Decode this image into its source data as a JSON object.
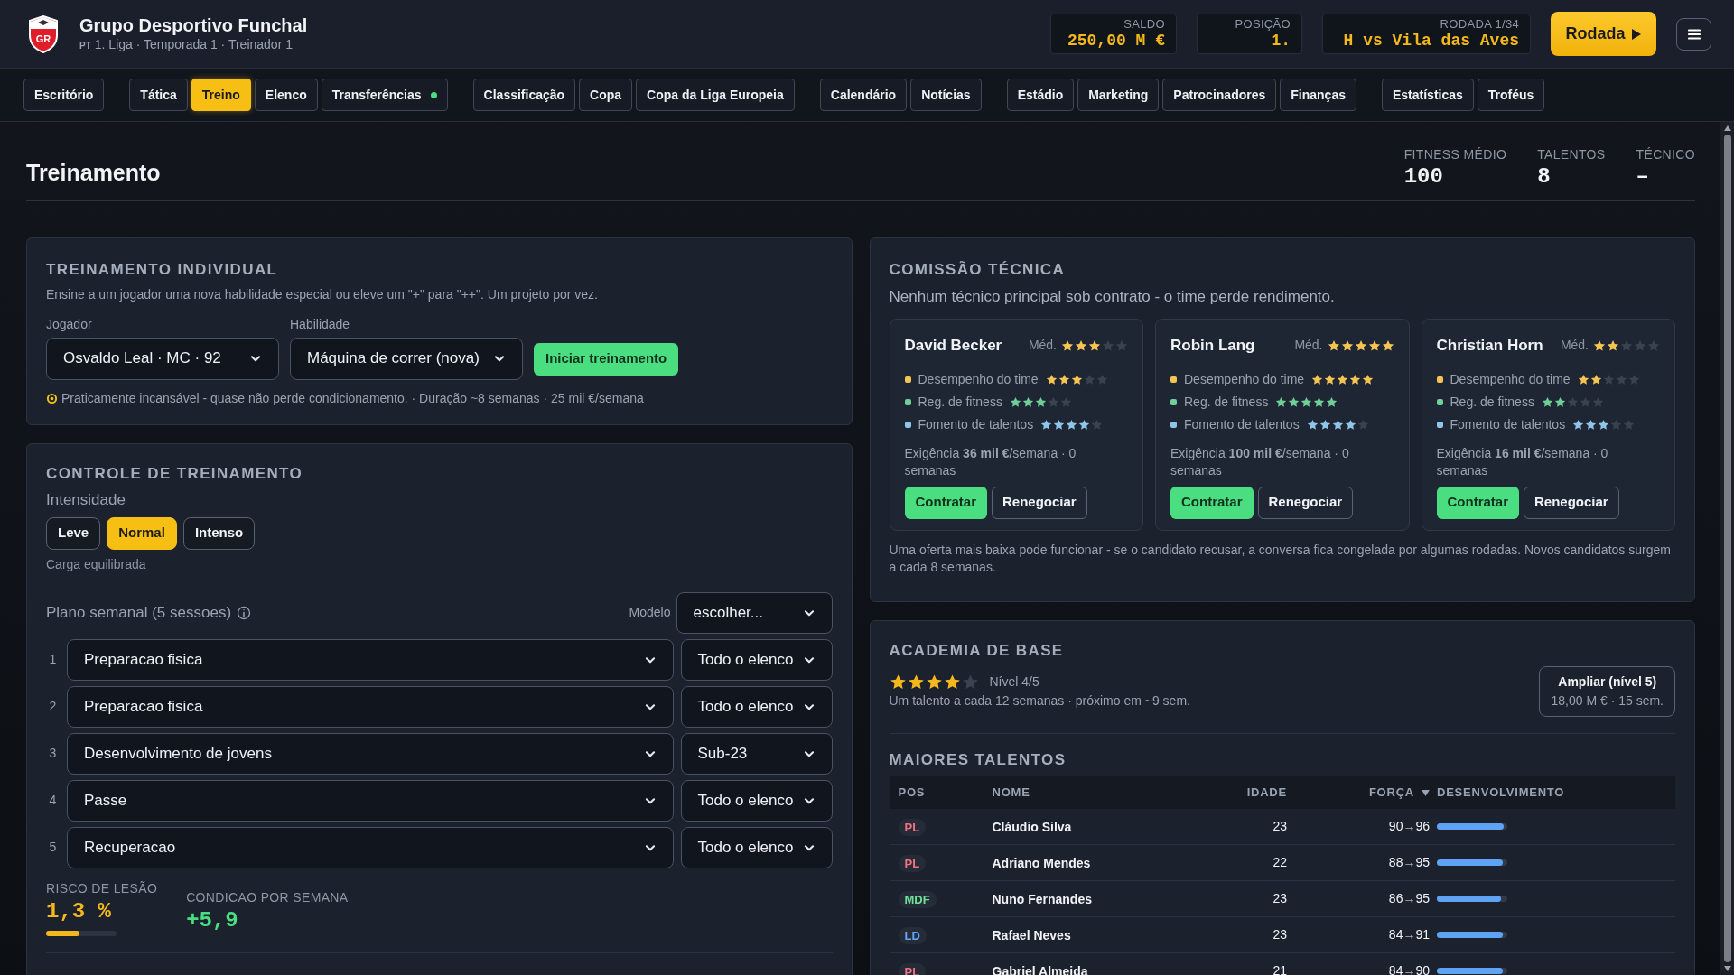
{
  "header": {
    "logo_text": "GR",
    "club": "Grupo Desportivo Funchal",
    "country": "PT",
    "subtitle": "1. Liga · Temporada 1 · Treinador 1",
    "stats": [
      {
        "label": "SALDO",
        "value": "250,00 M €"
      },
      {
        "label": "POSIÇÃO",
        "value": "1."
      },
      {
        "label": "RODADA 1/34",
        "value": "H vs Vila das Aves"
      }
    ],
    "round_button": "Rodada"
  },
  "nav": [
    [
      {
        "label": "Escritório",
        "selected": false,
        "notification": false
      }
    ],
    [
      {
        "label": "Tática",
        "selected": false,
        "notification": false
      },
      {
        "label": "Treino",
        "selected": true,
        "notification": false
      },
      {
        "label": "Elenco",
        "selected": false,
        "notification": false
      },
      {
        "label": "Transferências",
        "selected": false,
        "notification": true
      }
    ],
    [
      {
        "label": "Classificação",
        "selected": false,
        "notification": false
      },
      {
        "label": "Copa",
        "selected": false,
        "notification": false
      },
      {
        "label": "Copa da Liga Europeia",
        "selected": false,
        "notification": false
      }
    ],
    [
      {
        "label": "Calendário",
        "selected": false,
        "notification": false
      },
      {
        "label": "Notícias",
        "selected": false,
        "notification": false
      }
    ],
    [
      {
        "label": "Estádio",
        "selected": false,
        "notification": false
      },
      {
        "label": "Marketing",
        "selected": false,
        "notification": false
      },
      {
        "label": "Patrocinadores",
        "selected": false,
        "notification": false
      },
      {
        "label": "Finanças",
        "selected": false,
        "notification": false
      }
    ],
    [
      {
        "label": "Estatísticas",
        "selected": false,
        "notification": false
      },
      {
        "label": "Troféus",
        "selected": false,
        "notification": false
      }
    ]
  ],
  "page": {
    "title": "Treinamento",
    "stats": [
      {
        "label": "FITNESS MÉDIO",
        "value": "100"
      },
      {
        "label": "TALENTOS",
        "value": "8"
      },
      {
        "label": "TÉCNICO",
        "value": "–"
      }
    ]
  },
  "individual_training": {
    "title": "TREINAMENTO INDIVIDUAL",
    "description": "Ensine a um jogador uma nova habilidade especial ou eleve um \"+\" para \"++\". Um projeto por vez.",
    "player": {
      "label": "Jogador",
      "value": "Osvaldo Leal · MC · 92"
    },
    "skill": {
      "label": "Habilidade",
      "value": "Máquina de correr (nova)"
    },
    "start_button": "Iniciar treinamento",
    "hint": "Praticamente incansável - quase não perde condicionamento. · Duração ~8 semanas · 25 mil €/semana"
  },
  "training_control": {
    "title": "CONTROLE DE TREINAMENTO",
    "intensity_label": "Intensidade",
    "intensity": [
      {
        "label": "Leve",
        "selected": false
      },
      {
        "label": "Normal",
        "selected": true
      },
      {
        "label": "Intenso",
        "selected": false
      }
    ],
    "intensity_note": "Carga equilibrada",
    "plan_label": "Plano semanal (5 sessoes)",
    "template_label": "Modelo",
    "template_value": "escolher...",
    "sessions": [
      {
        "number": "1",
        "drill": "Preparacao fisica",
        "group": "Todo o elenco"
      },
      {
        "number": "2",
        "drill": "Preparacao fisica",
        "group": "Todo o elenco"
      },
      {
        "number": "3",
        "drill": "Desenvolvimento de jovens",
        "group": "Sub-23"
      },
      {
        "number": "4",
        "drill": "Passe",
        "group": "Todo o elenco"
      },
      {
        "number": "5",
        "drill": "Recuperacao",
        "group": "Todo o elenco"
      }
    ],
    "injury_risk": {
      "label": "RISCO DE LESÃO",
      "value": "1,3 %",
      "level": 0.48
    },
    "condition": {
      "label": "CONDICAO POR SEMANA",
      "value": "+5,9"
    }
  },
  "staff": {
    "title": "COMISSÃO TÉCNICA",
    "subtitle": "Nenhum técnico principal sob contrato - o time perde rendimento.",
    "candidates": [
      {
        "name": "David Becker",
        "avg_label": "Méd.",
        "stars": 3,
        "attributes": [
          {
            "label": "Desempenho do time",
            "color": "#f6c453",
            "stars": 3
          },
          {
            "label": "Reg. de fitness",
            "color": "#6fcf97",
            "stars": 3
          },
          {
            "label": "Fomento de talentos",
            "color": "#8ec5e8",
            "stars": 4
          }
        ],
        "demand": "Exigência **36 mil €**/semana · 0 semanas",
        "hire": "Contratar",
        "renegotiate": "Renegociar"
      },
      {
        "name": "Robin Lang",
        "avg_label": "Méd.",
        "stars": 5,
        "attributes": [
          {
            "label": "Desempenho do time",
            "color": "#f6c453",
            "stars": 5
          },
          {
            "label": "Reg. de fitness",
            "color": "#6fcf97",
            "stars": 5
          },
          {
            "label": "Fomento de talentos",
            "color": "#8ec5e8",
            "stars": 4
          }
        ],
        "demand": "Exigência **100 mil €**/semana · 0 semanas",
        "hire": "Contratar",
        "renegotiate": "Renegociar"
      },
      {
        "name": "Christian Horn",
        "avg_label": "Méd.",
        "stars": 2,
        "attributes": [
          {
            "label": "Desempenho do time",
            "color": "#f6c453",
            "stars": 2
          },
          {
            "label": "Reg. de fitness",
            "color": "#6fcf97",
            "stars": 2
          },
          {
            "label": "Fomento de talentos",
            "color": "#8ec5e8",
            "stars": 3
          }
        ],
        "demand": "Exigência **16 mil €**/semana · 0 semanas",
        "hire": "Contratar",
        "renegotiate": "Renegociar"
      }
    ],
    "footnote": "Uma oferta mais baixa pode funcionar - se o candidato recusar, a conversa fica congelada por algumas rodadas. Novos candidatos surgem a cada 8 semanas."
  },
  "academy": {
    "title": "ACADEMIA DE BASE",
    "stars": 4,
    "level_text": "Nível 4/5",
    "subtitle": "Um talento a cada 12 semanas · próximo em ~9 sem.",
    "upgrade": {
      "title": "Ampliar (nível 5)",
      "detail": "18,00 M € · 15 sem."
    },
    "talents_title": "MAIORES TALENTOS",
    "columns": [
      {
        "label": "POS",
        "sorted": false
      },
      {
        "label": "NOME",
        "sorted": false
      },
      {
        "label": "IDADE",
        "sorted": false
      },
      {
        "label": "FORÇA",
        "sorted": true
      },
      {
        "label": "DESENVOLVIMENTO",
        "sorted": false
      }
    ],
    "rows": [
      {
        "pos": "PL",
        "color": "#f47184",
        "name": "Cláudio Silva",
        "age": "23",
        "strength": "90→96",
        "level": 0.95
      },
      {
        "pos": "PL",
        "color": "#f47184",
        "name": "Adriano Mendes",
        "age": "22",
        "strength": "88→95",
        "level": 0.94
      },
      {
        "pos": "MDF",
        "color": "#6ee29a",
        "name": "Nuno Fernandes",
        "age": "23",
        "strength": "86→95",
        "level": 0.91
      },
      {
        "pos": "LD",
        "color": "#60a5fa",
        "name": "Rafael Neves",
        "age": "23",
        "strength": "84→91",
        "level": 0.94
      },
      {
        "pos": "PL",
        "color": "#f47184",
        "name": "Gabriel Almeida",
        "age": "21",
        "strength": "84→90",
        "level": 0.94
      }
    ]
  }
}
